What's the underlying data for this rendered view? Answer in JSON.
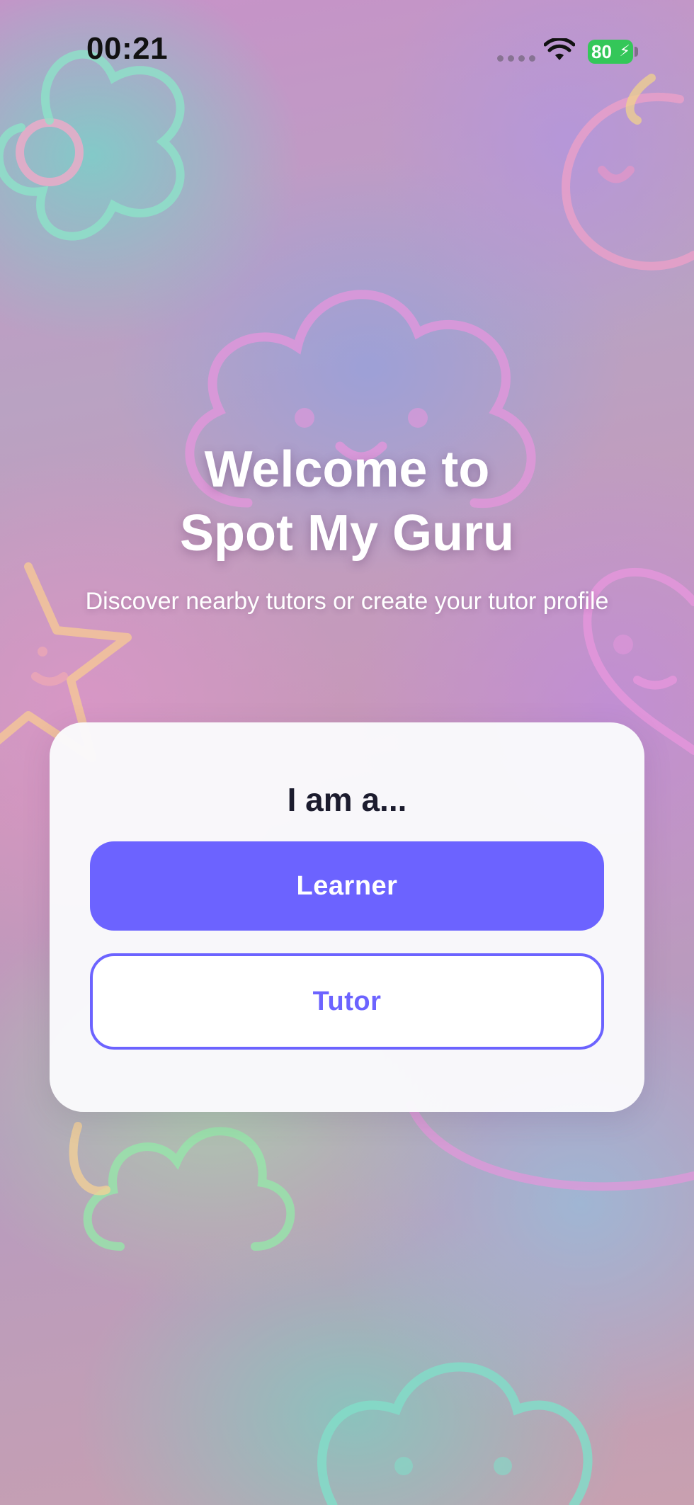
{
  "status_bar": {
    "time": "00:21",
    "battery_level": "80",
    "battery_color": "#34c759"
  },
  "welcome": {
    "line1": "Welcome to",
    "line2": "Spot My Guru",
    "subtitle": "Discover nearby tutors or create your tutor profile"
  },
  "role_card": {
    "title": "I am a...",
    "learner_label": "Learner",
    "tutor_label": "Tutor"
  },
  "colors": {
    "accent": "#6c63ff",
    "card_background": "#fafafc",
    "title_text": "#1c1c2e"
  },
  "icons": {
    "wifi": "wifi-icon",
    "battery": "battery-icon",
    "charging": "bolt-icon"
  }
}
